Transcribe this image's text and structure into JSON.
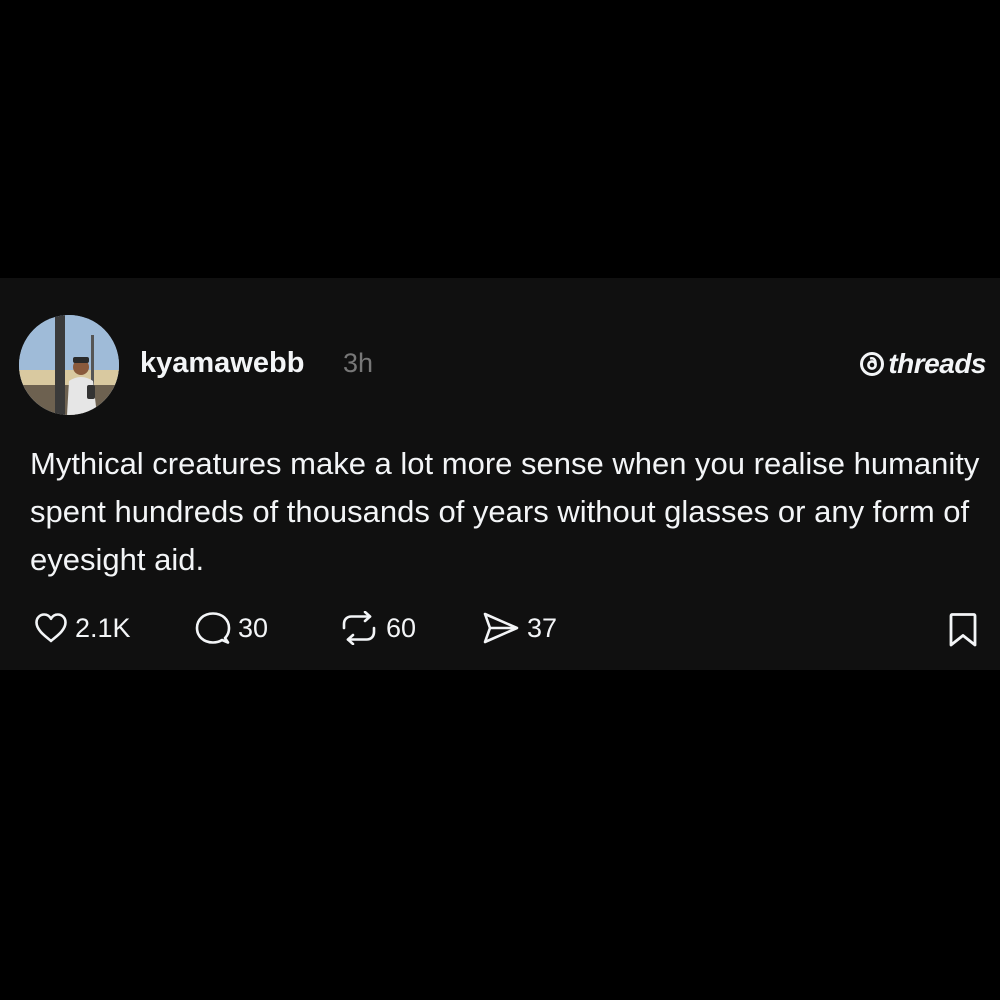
{
  "post": {
    "username": "kyamawebb",
    "timestamp": "3h",
    "brand": "threads",
    "text": "Mythical creatures make a lot more sense when you realise humanity spent hundreds of thousands of years without glasses or any form of eyesight aid.",
    "actions": {
      "like": {
        "icon": "heart-icon",
        "count": "2.1K"
      },
      "reply": {
        "icon": "speech-bubble-icon",
        "count": "30"
      },
      "repost": {
        "icon": "repost-icon",
        "count": "60"
      },
      "share": {
        "icon": "send-icon",
        "count": "37"
      },
      "save": {
        "icon": "bookmark-icon"
      }
    }
  },
  "colors": {
    "background": "#000000",
    "card": "#101010",
    "text": "#f3f5f7",
    "muted": "#777777"
  }
}
